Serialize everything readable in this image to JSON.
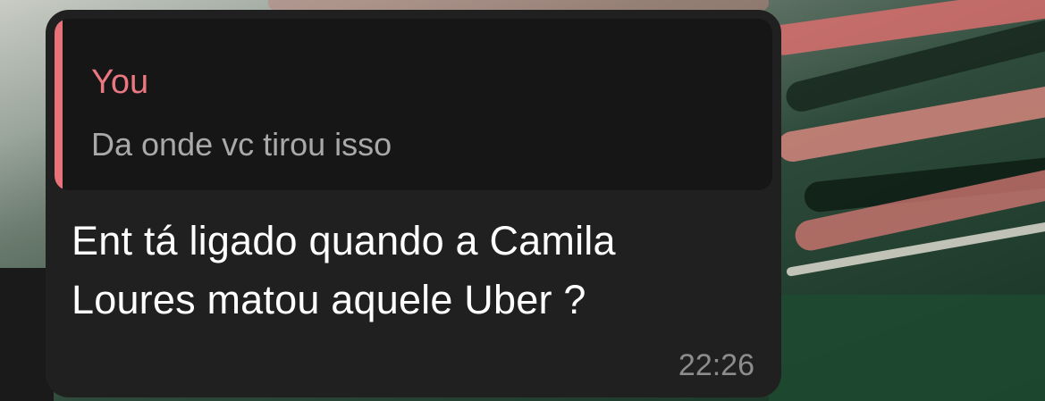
{
  "message": {
    "reply": {
      "author": "You",
      "text": "Da onde vc tirou isso"
    },
    "text_line1": "Ent tá ligado quando a Camila",
    "text_line2": "Loures matou aquele Uber ?",
    "time": "22:26"
  },
  "colors": {
    "bubble_bg": "#202020",
    "reply_bg": "#161616",
    "reply_accent": "#e8727a",
    "reply_author": "#eb7881",
    "reply_text": "#a9a9a9",
    "message_text": "#ffffff",
    "time_text": "#8d8d8d"
  }
}
